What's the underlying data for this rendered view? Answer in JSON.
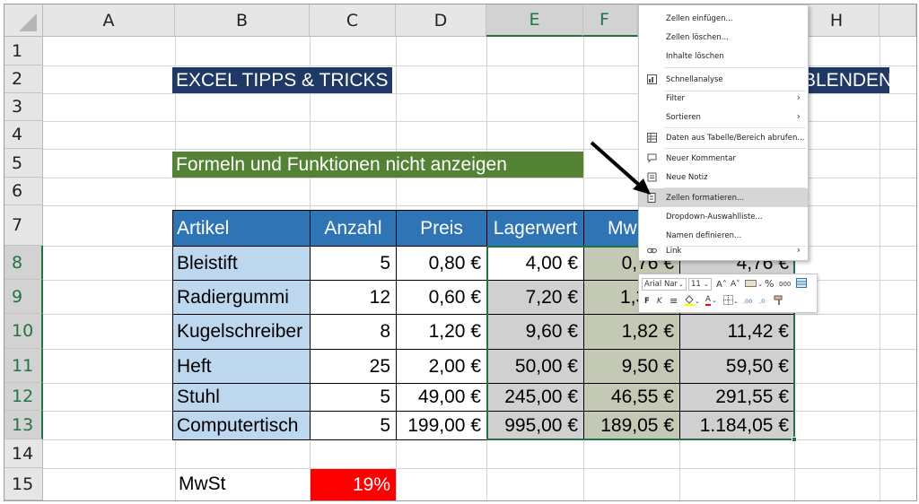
{
  "columns": [
    "A",
    "B",
    "C",
    "D",
    "E",
    "F",
    "H"
  ],
  "rows": [
    "1",
    "2",
    "3",
    "4",
    "5",
    "6",
    "7",
    "8",
    "9",
    "10",
    "11",
    "12",
    "13",
    "14",
    "15"
  ],
  "banner": {
    "left": "EXCEL TIPPS & TRICKS",
    "right": "BLENDEN"
  },
  "subtitle": "Formeln und Funktionen nicht anzeigen",
  "table": {
    "headers": [
      "Artikel",
      "Anzahl",
      "Preis",
      "Lagerwert",
      "Mw"
    ],
    "rows": [
      {
        "artikel": "Bleistift",
        "anzahl": "5",
        "preis": "0,80 €",
        "lagerwert": "4,00 €",
        "mwst": "0,76 €",
        "total": "4,76 €"
      },
      {
        "artikel": "Radiergummi",
        "anzahl": "12",
        "preis": "0,60 €",
        "lagerwert": "7,20 €",
        "mwst": "1,3",
        "total": ""
      },
      {
        "artikel": "Kugelschreiber",
        "anzahl": "8",
        "preis": "1,20 €",
        "lagerwert": "9,60 €",
        "mwst": "1,82 €",
        "total": "11,42 €"
      },
      {
        "artikel": "Heft",
        "anzahl": "25",
        "preis": "2,00 €",
        "lagerwert": "50,00 €",
        "mwst": "9,50 €",
        "total": "59,50 €"
      },
      {
        "artikel": "Stuhl",
        "anzahl": "5",
        "preis": "49,00 €",
        "lagerwert": "245,00 €",
        "mwst": "46,55 €",
        "total": "291,55 €"
      },
      {
        "artikel": "Computertisch",
        "anzahl": "5",
        "preis": "199,00 €",
        "lagerwert": "995,00 €",
        "mwst": "189,05 €",
        "total": "1.184,05 €"
      }
    ]
  },
  "mwst": {
    "label": "MwSt",
    "value": "19%"
  },
  "context_menu": {
    "items": [
      {
        "label": "Zellen einfügen...",
        "icon": ""
      },
      {
        "label": "Zellen löschen...",
        "icon": ""
      },
      {
        "label": "Inhalte löschen",
        "icon": ""
      },
      {
        "label": "Schnellanalyse",
        "icon": "quick-analysis-icon"
      },
      {
        "label": "Filter",
        "icon": "",
        "submenu": true
      },
      {
        "label": "Sortieren",
        "icon": "",
        "submenu": true
      },
      {
        "label": "Daten aus Tabelle/Bereich abrufen...",
        "icon": "table-icon"
      },
      {
        "label": "Neuer Kommentar",
        "icon": "comment-icon"
      },
      {
        "label": "Neue Notiz",
        "icon": "note-icon"
      },
      {
        "label": "Zellen formatieren...",
        "icon": "format-cells-icon",
        "highlighted": true
      },
      {
        "label": "Dropdown-Auswahlliste...",
        "icon": ""
      },
      {
        "label": "Namen definieren...",
        "icon": ""
      },
      {
        "label": "Link",
        "icon": "link-icon",
        "submenu": true
      }
    ]
  },
  "mini_toolbar": {
    "font_name": "Arial Nar",
    "font_size": "11",
    "grow": "A˄",
    "shrink": "A˅",
    "percent": "%",
    "thousands": "000",
    "bold": "F",
    "italic": "K",
    "align": "≡",
    "font_color": "A",
    "dec_inc": ",00",
    "dec_dec": ",0"
  },
  "colors": {
    "banner": "#1f3864",
    "subtitle": "#548235",
    "table_header": "#2f75b5",
    "table_article": "#bdd7ee",
    "mwst_value": "#ff0000",
    "selection": "#217346"
  }
}
